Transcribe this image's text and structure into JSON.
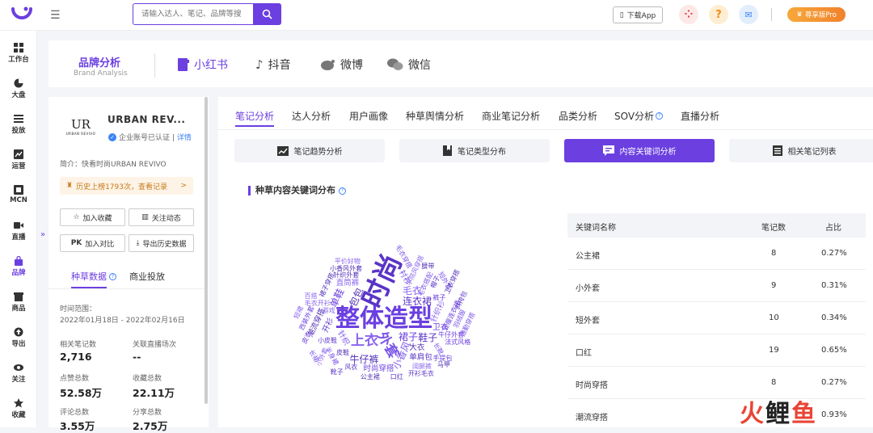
{
  "header": {
    "search_placeholder": "请输入达人、笔记、品牌等搜",
    "download_app": "下载App",
    "pro_label": "尊享版Pro",
    "help_icon": "?"
  },
  "sidebar": {
    "items": [
      {
        "label": "工作台",
        "icon": "grid-icon"
      },
      {
        "label": "大盘",
        "icon": "pie-icon"
      },
      {
        "label": "投放",
        "icon": "list-icon"
      },
      {
        "label": "运营",
        "icon": "chart-icon"
      },
      {
        "label": "MCN",
        "icon": "mcn-icon"
      },
      {
        "label": "直播",
        "icon": "video-icon"
      },
      {
        "label": "品牌",
        "icon": "bag-icon"
      },
      {
        "label": "商品",
        "icon": "box-icon"
      },
      {
        "label": "导出",
        "icon": "export-icon"
      },
      {
        "label": "关注",
        "icon": "eye-icon"
      },
      {
        "label": "收藏",
        "icon": "star-icon"
      }
    ],
    "active": "品牌"
  },
  "brand_header": {
    "title": "品牌分析",
    "subtitle": "Brand Analysis",
    "platforms": [
      "小红书",
      "抖音",
      "微博",
      "微信"
    ],
    "active_platform": "小红书"
  },
  "account": {
    "name": "URBAN REV...",
    "logo_text": "UR",
    "logo_sub": "URBAN REVIVO",
    "verify_text": "企业账号已认证 |",
    "verify_link": "详情",
    "intro": "简介：快看时尚URBAN REVIVO",
    "history": "历史上榜1793次，查看记录",
    "history_arrow": ">",
    "buttons": [
      "加入收藏",
      "关注动态",
      "加入对比",
      "导出历史数据"
    ],
    "tabs": [
      "种草数据",
      "商业投放"
    ],
    "active_tab": "种草数据",
    "range_label": "时间范围：",
    "range_value": "2022年01月18日 - 2022年02月16日",
    "metrics": [
      {
        "label": "相关笔记数",
        "value": "2,716"
      },
      {
        "label": "关联直播场次",
        "value": "--"
      },
      {
        "label": "点赞总数",
        "value": "52.58万"
      },
      {
        "label": "收藏总数",
        "value": "22.11万"
      },
      {
        "label": "评论总数",
        "value": "3.55万"
      },
      {
        "label": "分享总数",
        "value": "2.75万"
      }
    ]
  },
  "main": {
    "tabs": [
      "笔记分析",
      "达人分析",
      "用户画像",
      "种草舆情分析",
      "商业笔记分析",
      "品类分析",
      "SOV分析",
      "直播分析"
    ],
    "active_tab": "笔记分析",
    "subtabs": [
      "笔记趋势分析",
      "笔记类型分布",
      "内容关键词分析",
      "相关笔记列表"
    ],
    "active_subtab": "内容关键词分析",
    "section_title": "种草内容关键词分布",
    "table": {
      "headers": [
        "关键词名称",
        "笔记数",
        "占比"
      ],
      "rows": [
        {
          "keyword": "公主裙",
          "count": "8",
          "ratio": "0.27%"
        },
        {
          "keyword": "小外套",
          "count": "9",
          "ratio": "0.31%"
        },
        {
          "keyword": "短外套",
          "count": "10",
          "ratio": "0.34%"
        },
        {
          "keyword": "口红",
          "count": "19",
          "ratio": "0.65%"
        },
        {
          "keyword": "时尚穿搭",
          "count": "8",
          "ratio": "0.27%"
        },
        {
          "keyword": "潮流穿搭",
          "count": "27",
          "ratio": "0.93%"
        }
      ]
    }
  },
  "wordcloud": {
    "words": [
      "整体造型",
      "时尚",
      "外套",
      "上衣",
      "包包",
      "裙子",
      "连衣裙",
      "小香风",
      "毛衣",
      "牛仔裤",
      "单鞋",
      "鞋子",
      "针织",
      "针织衫",
      "大衣",
      "卫衣",
      "开衫",
      "衬衫",
      "直筒裤",
      "潮流穿搭",
      "时尚穿搭",
      "单肩包",
      "毛衣搭配",
      "游戏",
      "皮鞋",
      "显瘦连衣裙",
      "小皮鞋",
      "长靴",
      "学院风穿搭",
      "针织外套",
      "裤子",
      "帽子",
      "半身裙",
      "毛衣开衫",
      "裙子穿搭",
      "牛仔外套",
      "风衣",
      "羽绒服",
      "阔腿裤",
      "小香风外套",
      "西装外套",
      "口红",
      "短外套",
      "小外套",
      "公主裙",
      "手提包",
      "斜挎包",
      "毛衣穿搭",
      "百搭",
      "卫衣穿搭",
      "法式风格",
      "开衫毛衣",
      "通勤穿搭",
      "平价好物",
      "腰带",
      "皮衣",
      "靴子",
      "长裙",
      "短裙",
      "马甲"
    ]
  },
  "watermark": {
    "a": "火",
    "b": "鲤",
    "c": "鱼"
  }
}
